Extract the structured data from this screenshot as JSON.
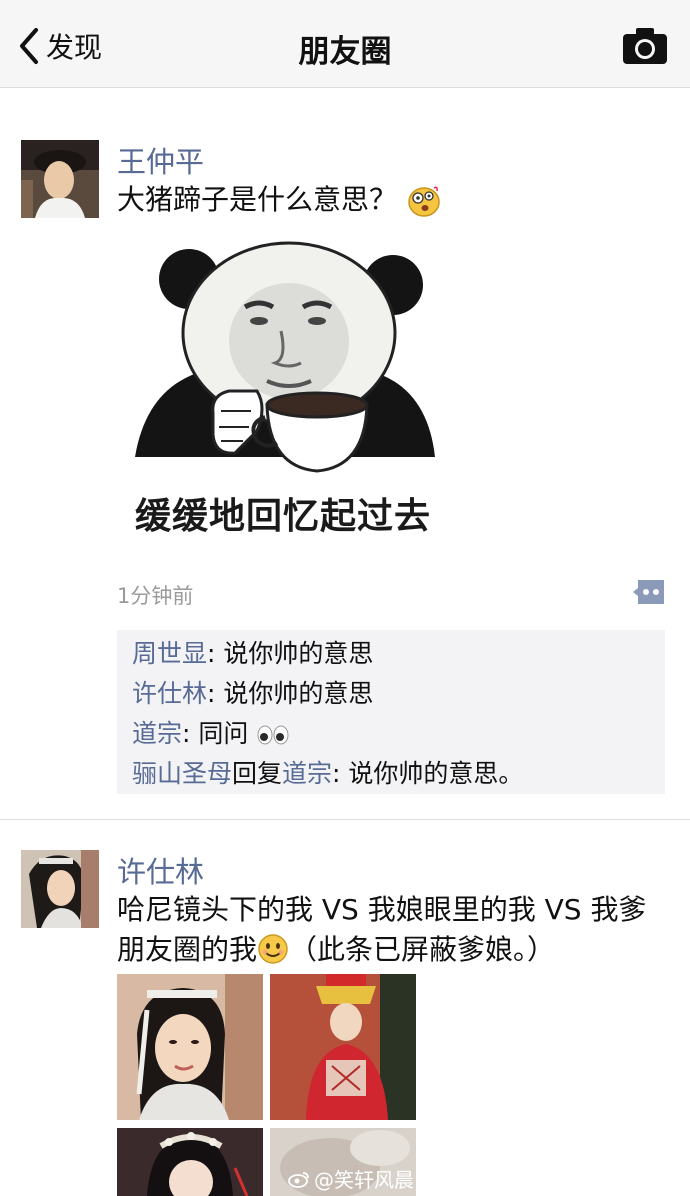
{
  "nav": {
    "back_label": "发现",
    "title": "朋友圈"
  },
  "post1": {
    "name": "王仲平",
    "text": "大猪蹄子是什么意思？",
    "meme_caption": "缓缓地回忆起过去",
    "time": "1分钟前",
    "comments": [
      {
        "from": "周世显",
        "reply_word": "",
        "to": "",
        "text": ": 说你帅的意思"
      },
      {
        "from": "许仕林",
        "reply_word": "",
        "to": "",
        "text": ": 说你帅的意思"
      },
      {
        "from": "道宗",
        "reply_word": "",
        "to": "",
        "text": ": 同问"
      },
      {
        "from": "骊山圣母",
        "reply_word": "回复",
        "to": "道宗",
        "text": ": 说你帅的意思。"
      }
    ]
  },
  "post2": {
    "name": "许仕林",
    "text_line1": "哈尼镜头下的我 VS 我娘眼里的我 VS 我爹",
    "text_line2": "朋友圈的我",
    "text_line2_tail": "（此条已屏蔽爹娘。）"
  },
  "watermark": "@笑轩风晨",
  "colors": {
    "link_blue": "#576b95",
    "nav_bg": "#f6f6f6",
    "comment_bg": "#f3f3f5",
    "time_gray": "#9a9a9a"
  },
  "icons": [
    "chevron-left-icon",
    "camera-icon",
    "dizzy-emoji-icon",
    "eyes-emoji-icon",
    "smile-emoji-icon",
    "comment-dots-icon",
    "weibo-icon"
  ]
}
